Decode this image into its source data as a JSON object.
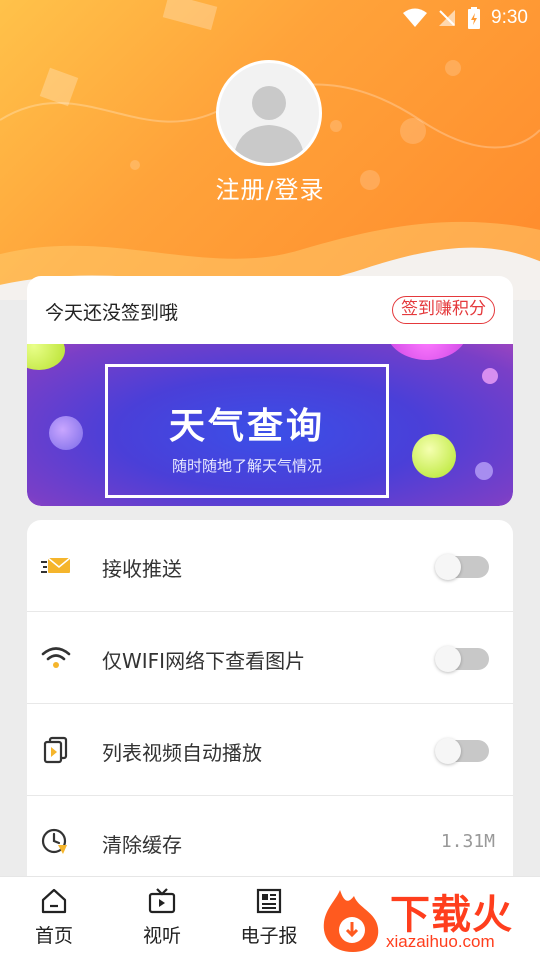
{
  "status_bar": {
    "time": "9:30"
  },
  "profile": {
    "login_label": "注册/登录"
  },
  "sign_in": {
    "prompt": "今天还没签到哦",
    "button_label": "签到赚积分"
  },
  "banner": {
    "title": "天气查询",
    "subtitle": "随时随地了解天气情况"
  },
  "settings": {
    "items": [
      {
        "label": "接收推送",
        "icon": "envelope-icon",
        "control": "toggle",
        "on": false
      },
      {
        "label": "仅WIFI网络下查看图片",
        "icon": "wifi-icon",
        "control": "toggle",
        "on": false
      },
      {
        "label": "列表视频自动播放",
        "icon": "video-play-icon",
        "control": "toggle",
        "on": false
      },
      {
        "label": "清除缓存",
        "icon": "clock-icon",
        "control": "value",
        "value": "1.31M"
      }
    ]
  },
  "bottom_nav": {
    "items": [
      {
        "label": "首页",
        "icon": "home-icon"
      },
      {
        "label": "视听",
        "icon": "tv-icon"
      },
      {
        "label": "电子报",
        "icon": "newspaper-icon"
      }
    ]
  },
  "watermark": {
    "brand": "下载火",
    "url": "xiazaihuo.com"
  },
  "colors": {
    "header_start": "#ffc24a",
    "header_end": "#ff8a2c",
    "accent_red": "#e4393c",
    "banner_blue": "#3b4fe8"
  }
}
